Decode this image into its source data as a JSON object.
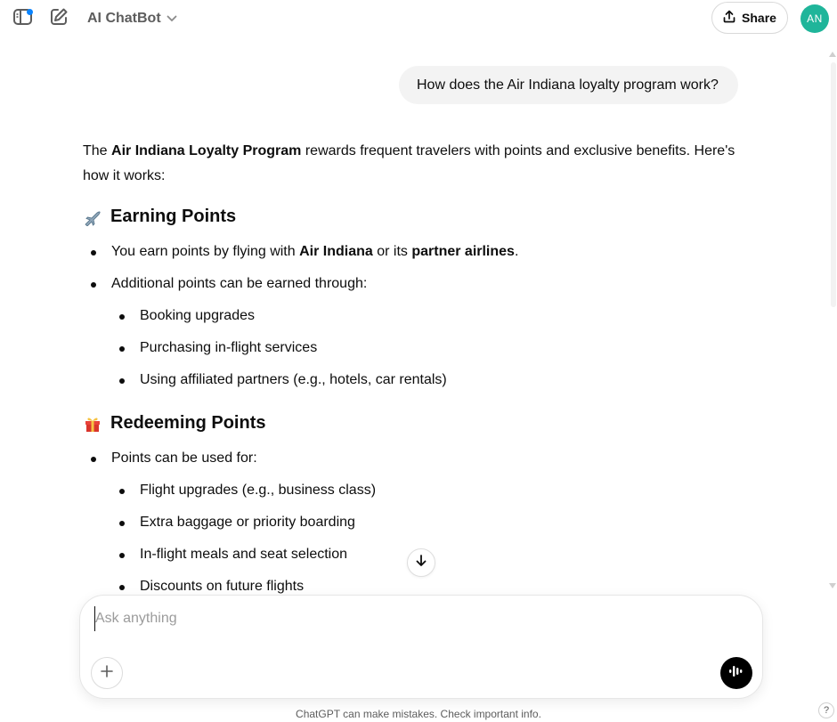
{
  "header": {
    "sidebar_icon": "sidebar-toggle-icon",
    "new_chat_icon": "edit-icon",
    "model_name": "AI ChatBot",
    "share_label": "Share",
    "avatar_initials": "AN"
  },
  "conversation": {
    "user_message": "How does the Air Indiana loyalty program work?",
    "intro": {
      "pre": "The ",
      "bold": "Air Indiana Loyalty Program",
      "post": " rewards frequent travelers with points and exclusive benefits. Here's how it works:"
    },
    "sections": [
      {
        "emoji": "airplane-icon",
        "title": "Earning Points",
        "items": [
          {
            "t1": "You earn points by flying with ",
            "b1": "Air Indiana",
            "t2": " or its ",
            "b2": "partner airlines",
            "t3": "."
          },
          {
            "text": "Additional points can be earned through:",
            "subitems": [
              "Booking upgrades",
              "Purchasing in-flight services",
              "Using affiliated partners (e.g., hotels, car rentals)"
            ]
          }
        ]
      },
      {
        "emoji": "gift-icon",
        "title": "Redeeming Points",
        "items": [
          {
            "text": "Points can be used for:",
            "subitems": [
              "Flight upgrades (e.g., business class)",
              "Extra baggage or priority boarding",
              "In-flight meals and seat selection",
              "Discounts on future flights"
            ]
          }
        ]
      }
    ]
  },
  "composer": {
    "placeholder": "Ask anything"
  },
  "footer": {
    "disclaimer": "ChatGPT can make mistakes. Check important info.",
    "help_label": "?"
  },
  "colors": {
    "avatar": "#1fb59a",
    "notify_dot": "#0a84ff",
    "user_bubble": "#f3f3f3"
  }
}
